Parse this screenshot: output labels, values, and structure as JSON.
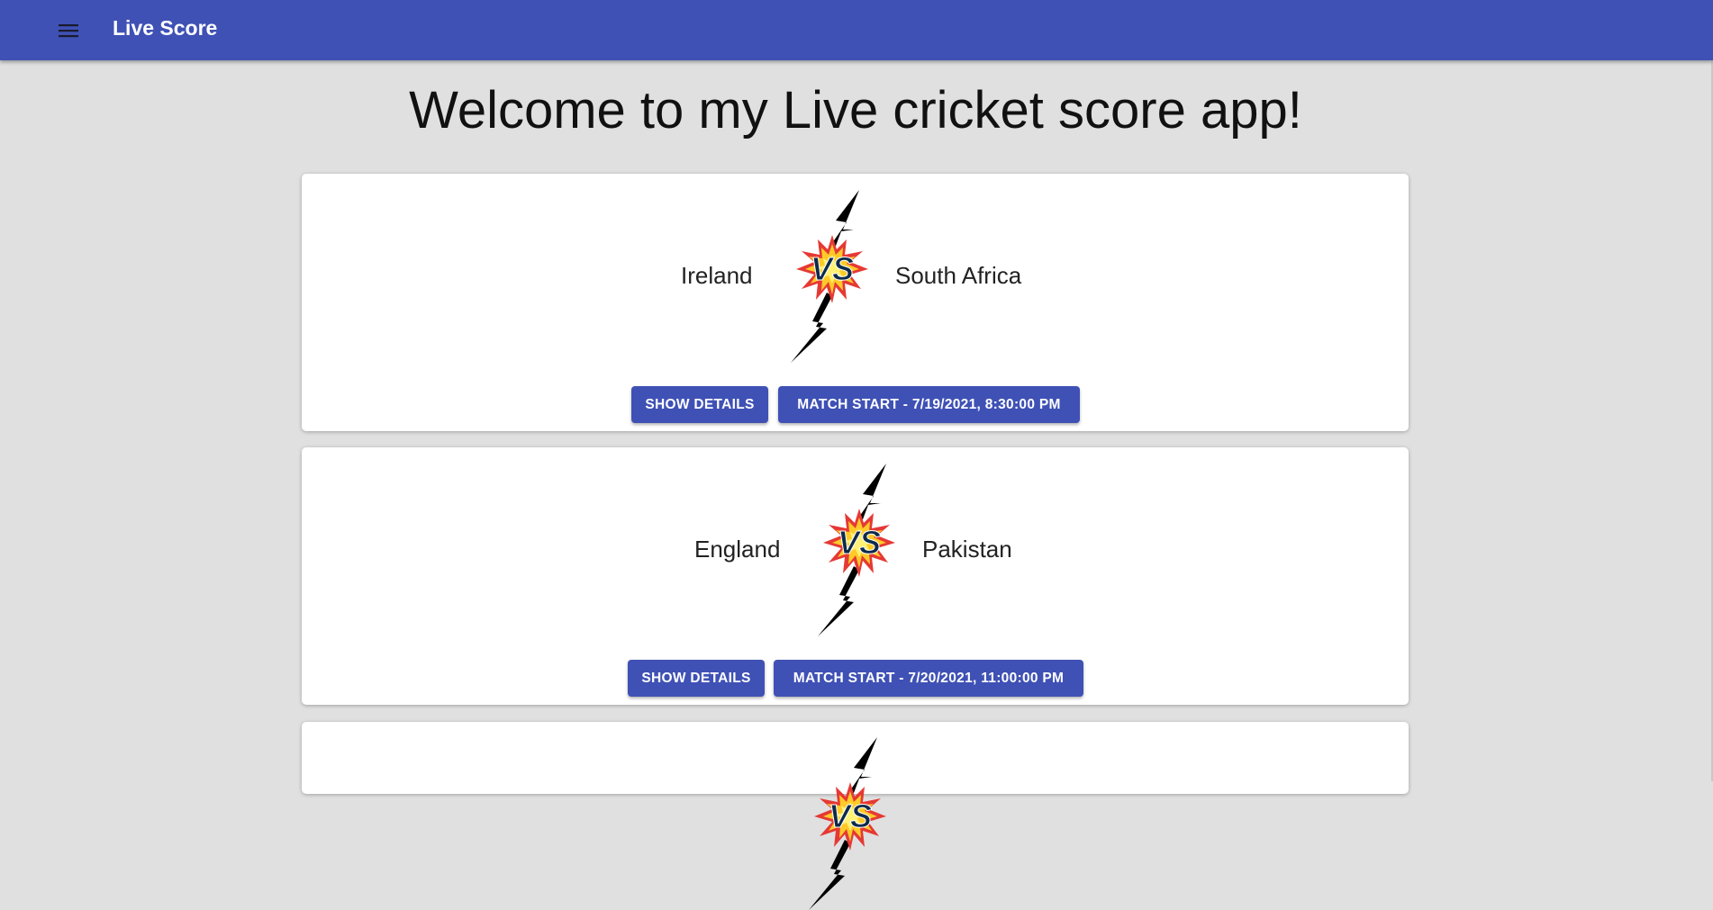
{
  "toolbar": {
    "title": "Live Score",
    "menu_icon": "menu-icon"
  },
  "page": {
    "heading": "Welcome to my Live cricket score app!"
  },
  "matches": [
    {
      "team1": "Ireland",
      "team2": "South Africa",
      "details_label": "SHOW DETAILS",
      "start_label": "MATCH START - 7/19/2021, 8:30:00 PM"
    },
    {
      "team1": "England",
      "team2": "Pakistan",
      "details_label": "SHOW DETAILS",
      "start_label": "MATCH START - 7/20/2021, 11:00:00 PM"
    }
  ],
  "colors": {
    "primary": "#3f51b5",
    "background": "#e0e0e0",
    "card": "#ffffff"
  }
}
